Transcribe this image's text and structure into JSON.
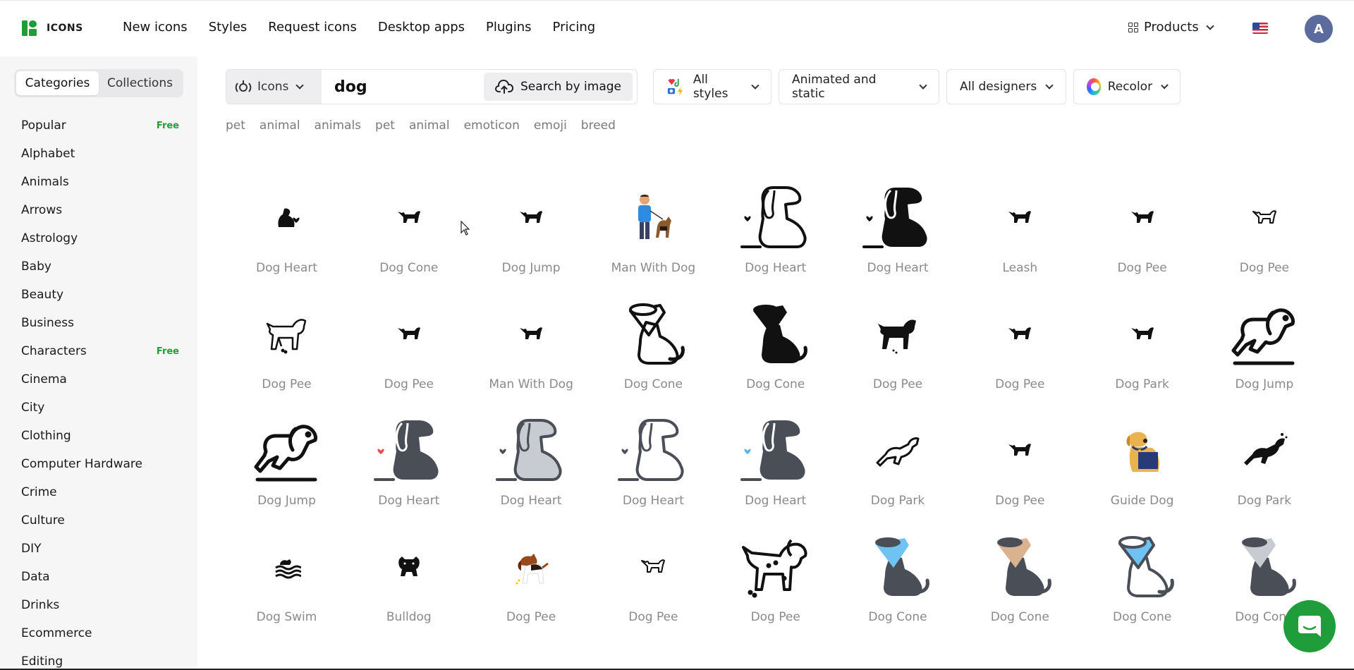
{
  "brand": {
    "name": "ICONS",
    "color": "#1f9d3a"
  },
  "nav": [
    "New icons",
    "Styles",
    "Request icons",
    "Desktop apps",
    "Plugins",
    "Pricing"
  ],
  "products_label": "Products",
  "avatar_initial": "A",
  "sidebar": {
    "tabs": [
      "Categories",
      "Collections"
    ],
    "categories": [
      {
        "label": "Popular",
        "badge": "Free"
      },
      {
        "label": "Alphabet",
        "badge": ""
      },
      {
        "label": "Animals",
        "badge": ""
      },
      {
        "label": "Arrows",
        "badge": ""
      },
      {
        "label": "Astrology",
        "badge": ""
      },
      {
        "label": "Baby",
        "badge": ""
      },
      {
        "label": "Beauty",
        "badge": ""
      },
      {
        "label": "Business",
        "badge": ""
      },
      {
        "label": "Characters",
        "badge": "Free"
      },
      {
        "label": "Cinema",
        "badge": ""
      },
      {
        "label": "City",
        "badge": ""
      },
      {
        "label": "Clothing",
        "badge": ""
      },
      {
        "label": "Computer Hardware",
        "badge": ""
      },
      {
        "label": "Crime",
        "badge": ""
      },
      {
        "label": "Culture",
        "badge": ""
      },
      {
        "label": "DIY",
        "badge": ""
      },
      {
        "label": "Data",
        "badge": ""
      },
      {
        "label": "Drinks",
        "badge": ""
      },
      {
        "label": "Ecommerce",
        "badge": ""
      },
      {
        "label": "Editing",
        "badge": ""
      }
    ]
  },
  "search": {
    "type_label": "Icons",
    "query": "dog",
    "by_image_label": "Search by image"
  },
  "filters": {
    "styles": "All styles",
    "animation": "Animated and static",
    "designers": "All designers",
    "recolor": "Recolor"
  },
  "tags": [
    "pet",
    "animal",
    "animals",
    "pet",
    "animal",
    "emoticon",
    "emoji",
    "breed"
  ],
  "icons": [
    {
      "label": "Dog Heart",
      "style": "small-solid-heart"
    },
    {
      "label": "Dog Cone",
      "style": "small-solid"
    },
    {
      "label": "Dog Jump",
      "style": "small-solid"
    },
    {
      "label": "Man With Dog",
      "style": "color-man"
    },
    {
      "label": "Dog Heart",
      "style": "big-outline-heart"
    },
    {
      "label": "Dog Heart",
      "style": "big-solid-heart"
    },
    {
      "label": "Leash",
      "style": "small-solid"
    },
    {
      "label": "Dog Pee",
      "style": "small-solid"
    },
    {
      "label": "Dog Pee",
      "style": "small-outline"
    },
    {
      "label": "Dog Pee",
      "style": "mid-outline"
    },
    {
      "label": "Dog Pee",
      "style": "small-solid"
    },
    {
      "label": "Man With Dog",
      "style": "small-solid"
    },
    {
      "label": "Dog Cone",
      "style": "big-outline-cone"
    },
    {
      "label": "Dog Cone",
      "style": "big-solid-cone"
    },
    {
      "label": "Dog Pee",
      "style": "mid-solid"
    },
    {
      "label": "Dog Pee",
      "style": "small-solid"
    },
    {
      "label": "Dog Park",
      "style": "small-solid"
    },
    {
      "label": "Dog Jump",
      "style": "big-outline-jump"
    },
    {
      "label": "Dog Jump",
      "style": "big-outline-jump"
    },
    {
      "label": "Dog Heart",
      "style": "big-gray-heart-red"
    },
    {
      "label": "Dog Heart",
      "style": "big-lightgray-heart"
    },
    {
      "label": "Dog Heart",
      "style": "big-outline-heart-gray"
    },
    {
      "label": "Dog Heart",
      "style": "big-gray-heart-blue"
    },
    {
      "label": "Dog Park",
      "style": "mid-outline-jump"
    },
    {
      "label": "Dog Pee",
      "style": "small-solid"
    },
    {
      "label": "Guide Dog",
      "style": "color-guide"
    },
    {
      "label": "Dog Park",
      "style": "mid-solid-jump"
    },
    {
      "label": "Dog Swim",
      "style": "small-swim"
    },
    {
      "label": "Bulldog",
      "style": "small-bulldog"
    },
    {
      "label": "Dog Pee",
      "style": "color-beagle"
    },
    {
      "label": "Dog Pee",
      "style": "small-outline"
    },
    {
      "label": "Dog Pee",
      "style": "big-outline-pee"
    },
    {
      "label": "Dog Cone",
      "style": "cone-blue"
    },
    {
      "label": "Dog Cone",
      "style": "cone-tan"
    },
    {
      "label": "Dog Cone",
      "style": "cone-outline-blue"
    },
    {
      "label": "Dog Cone",
      "style": "cone-gray"
    }
  ]
}
